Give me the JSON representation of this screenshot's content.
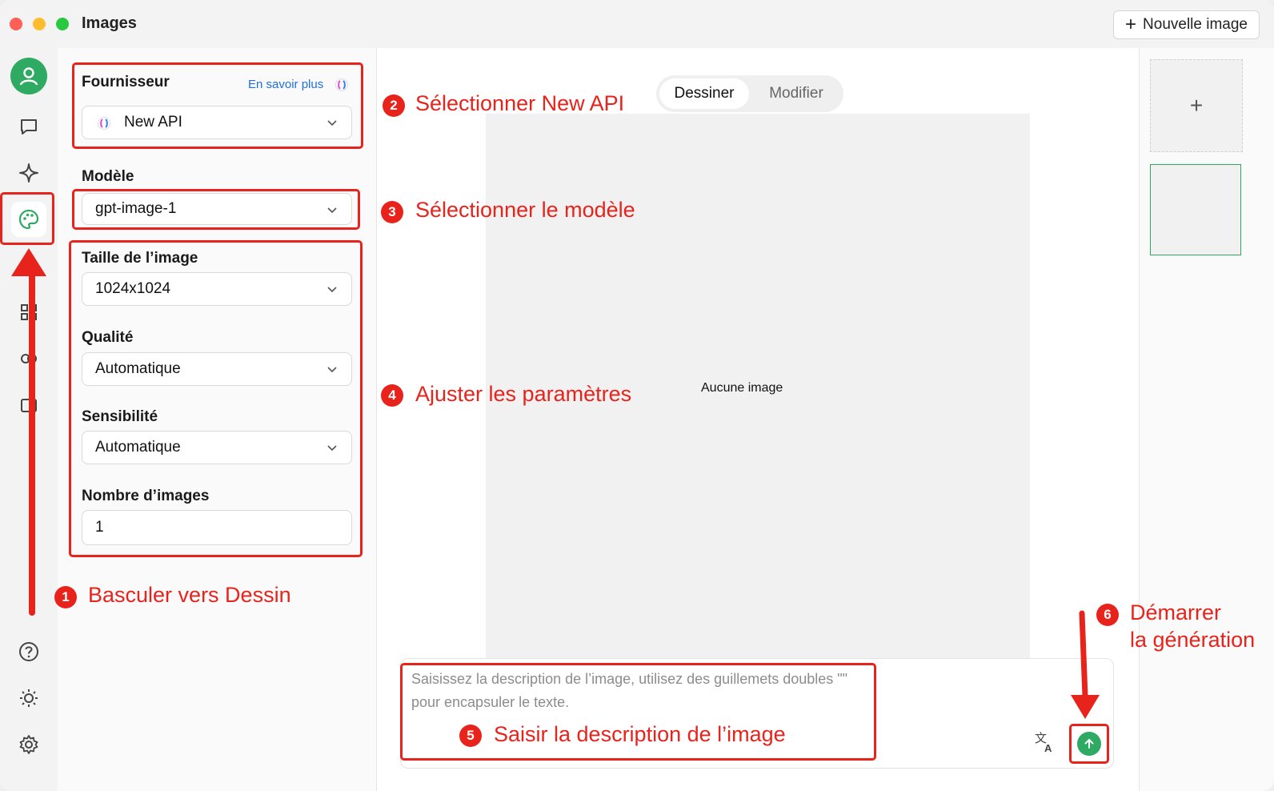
{
  "window": {
    "title": "Images",
    "new_image_label": "Nouvelle image"
  },
  "settings": {
    "provider": {
      "label": "Fournisseur",
      "learn_more": "En savoir plus",
      "value": "New API"
    },
    "model": {
      "label": "Modèle",
      "value": "gpt-image-1"
    },
    "size": {
      "label": "Taille de l’image",
      "value": "1024x1024"
    },
    "quality": {
      "label": "Qualité",
      "value": "Automatique"
    },
    "sensitivity": {
      "label": "Sensibilité",
      "value": "Automatique"
    },
    "count": {
      "label": "Nombre d’images",
      "value": "1"
    }
  },
  "main": {
    "tabs": [
      {
        "label": "Dessiner",
        "active": true
      },
      {
        "label": "Modifier",
        "active": false
      }
    ],
    "empty_text": "Aucune image",
    "prompt_placeholder": "Saisissez la description de l’image, utilisez des guillemets doubles \"\" pour encapsuler le texte."
  },
  "thumbnails": {
    "add_label": "+"
  },
  "annotations": [
    {
      "num": "1",
      "text": "Basculer vers Dessin"
    },
    {
      "num": "2",
      "text": "Sélectionner New API"
    },
    {
      "num": "3",
      "text": "Sélectionner le modèle"
    },
    {
      "num": "4",
      "text": "Ajuster les paramètres"
    },
    {
      "num": "5",
      "text": "Saisir la description de l’image"
    },
    {
      "num": "6",
      "text_line1": "Démarrer",
      "text_line2": "la génération"
    }
  ],
  "colors": {
    "accent": "#2eaa63",
    "annotation": "#e8231c",
    "link": "#1f6fe0"
  },
  "icons": {
    "nav": [
      "avatar",
      "chat-icon",
      "sparkle-icon",
      "palette-icon",
      "help-icon",
      "theme-icon",
      "gear-icon"
    ],
    "provider": "new-api-logo-icon",
    "prompt_tools": [
      "translate-icon",
      "send-arrow-icon"
    ]
  }
}
